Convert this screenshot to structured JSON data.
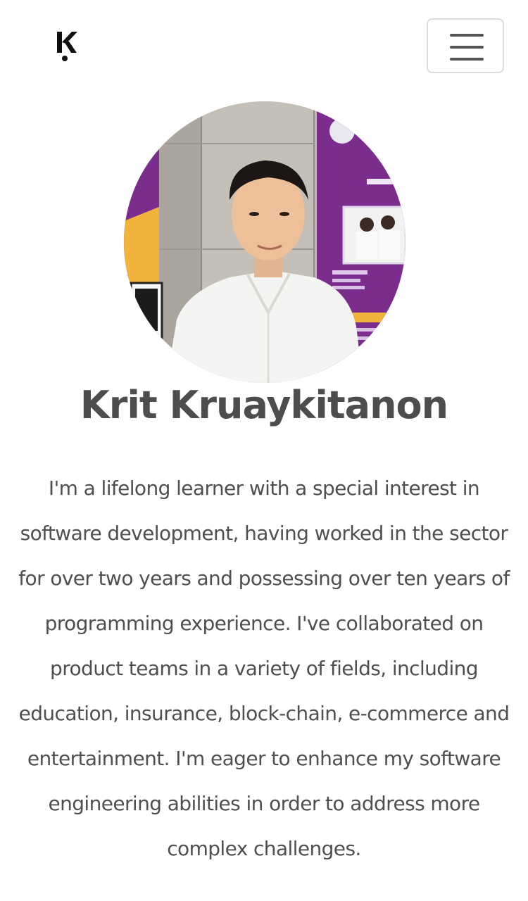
{
  "header": {
    "logo_icon": "k-logo-icon",
    "menu_icon": "hamburger-menu-icon"
  },
  "profile": {
    "avatar_icon": "profile-photo",
    "name": "Krit Kruaykitanon",
    "bio": "I'm a lifelong learner with a special interest in software development, having worked in the sector for over two years and possessing over ten years of programming experience. I've collaborated on product teams in a variety of fields, including education, insurance, block-chain, e-commerce and entertainment. I'm eager to enhance my software engineering abilities in order to address more complex challenges."
  },
  "colors": {
    "background": "#ffffff",
    "text": "#4d4d4d",
    "accent_purple": "#7b2d8e",
    "accent_yellow": "#f2b33d"
  }
}
